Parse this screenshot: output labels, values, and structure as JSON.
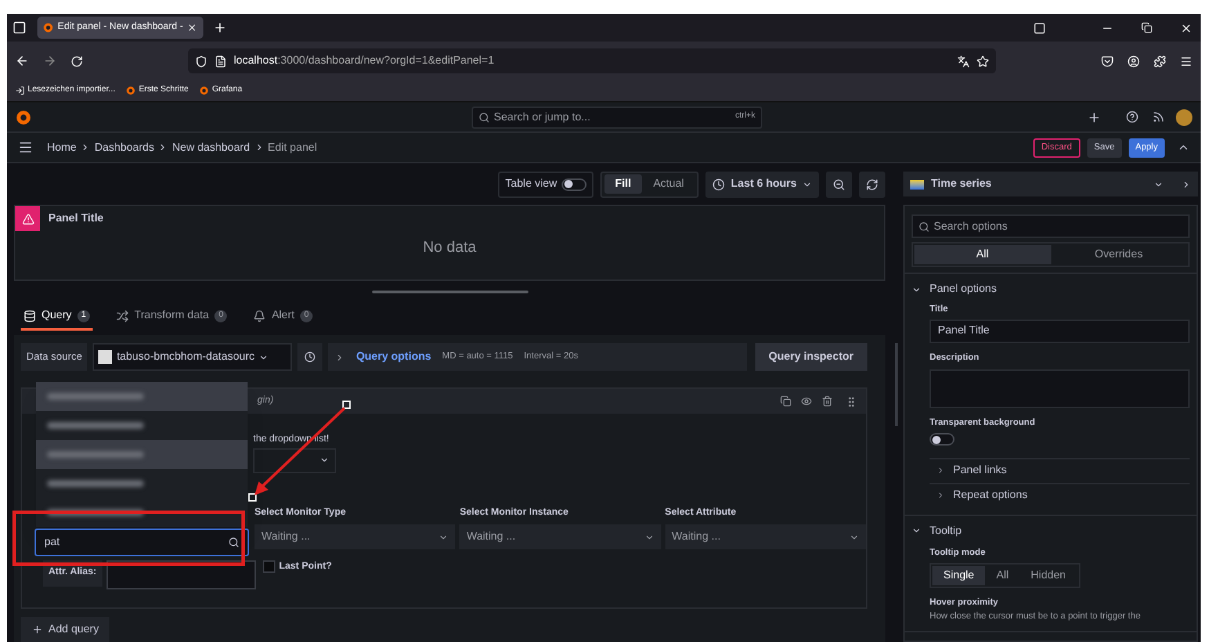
{
  "browser": {
    "tab_title": "Edit panel - New dashboard -",
    "url_host": "localhost",
    "url_path": ":3000/dashboard/new?orgId=1&editPanel=1",
    "bookmarks": [
      "Lesezeichen importier...",
      "Erste Schritte",
      "Grafana"
    ]
  },
  "topbar": {
    "search_placeholder": "Search or jump to...",
    "shortcut": "ctrl+k"
  },
  "breadcrumbs": [
    "Home",
    "Dashboards",
    "New dashboard",
    "Edit panel"
  ],
  "actions": [
    {
      "label": "Discard",
      "kind": "danger"
    },
    {
      "label": "Save",
      "kind": "secondary"
    },
    {
      "label": "Apply",
      "kind": "primary"
    }
  ],
  "toolbar": {
    "table_view": {
      "label": "Table view",
      "on": false
    },
    "modes": [
      {
        "label": "Fill",
        "selected": true
      },
      {
        "label": "Actual",
        "selected": false
      }
    ],
    "time_range": "Last 6 hours"
  },
  "panel": {
    "title": "Panel Title",
    "message": "No data"
  },
  "editor_tabs": [
    {
      "label": "Query",
      "count": "1",
      "selected": true,
      "kind": "query"
    },
    {
      "label": "Transform data",
      "count": "0",
      "selected": false,
      "kind": "transform"
    },
    {
      "label": "Alert",
      "count": "0",
      "selected": false,
      "kind": "alert"
    }
  ],
  "datasource": {
    "label": "Data source",
    "name": "tabuso-bmcbhom-datasourc",
    "query_options": "Query options",
    "md": "MD = auto = 1115",
    "interval": "Interval = 20s",
    "inspector": "Query inspector"
  },
  "query": {
    "header_fragment": "gin)",
    "hint_fragment": "the dropdown list!",
    "selects": [
      {
        "label": "Select Monitor Type",
        "value": "Waiting ..."
      },
      {
        "label": "Select Monitor Instance",
        "value": "Waiting ..."
      },
      {
        "label": "Select Attribute",
        "value": "Waiting ..."
      }
    ],
    "alias_label": "Attr. Alias:",
    "last_point": {
      "label": "Last Point?",
      "checked": false
    },
    "add_query": "Add query"
  },
  "dropdown": {
    "value": "pat",
    "options": [
      {
        "highlighted": true
      },
      {
        "highlighted": false
      },
      {
        "highlighted": true
      },
      {
        "highlighted": false
      },
      {
        "highlighted": false
      }
    ]
  },
  "options_pane": {
    "visualization": "Time series",
    "search_placeholder": "Search options",
    "tabs": [
      {
        "label": "All",
        "selected": true
      },
      {
        "label": "Overrides",
        "selected": false
      }
    ],
    "sections": [
      {
        "title": "Panel options",
        "expanded": true,
        "kind": "panel"
      },
      {
        "title": "Tooltip",
        "expanded": true,
        "kind": "tooltip"
      }
    ],
    "title_label": "Title",
    "title_value": "Panel Title",
    "description_label": "Description",
    "transparent": {
      "label": "Transparent background",
      "on": false
    },
    "subsections": [
      {
        "title": "Panel links",
        "expanded": false
      },
      {
        "title": "Repeat options",
        "expanded": false
      }
    ],
    "tooltip_mode_label": "Tooltip mode",
    "tooltip_modes": [
      {
        "label": "Single",
        "selected": true
      },
      {
        "label": "All",
        "selected": false
      },
      {
        "label": "Hidden",
        "selected": false
      }
    ],
    "hover_label": "Hover proximity",
    "hover_description": "How close the cursor must be to a point to trigger the"
  }
}
